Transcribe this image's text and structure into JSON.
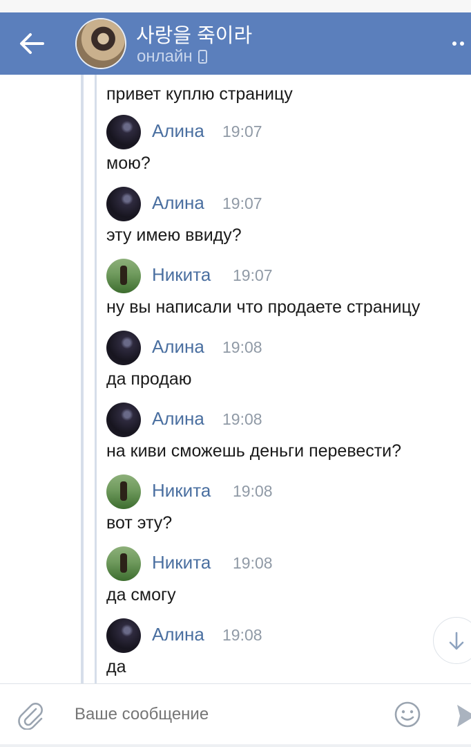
{
  "header": {
    "title": "사랑을 죽이라",
    "status": "онлайн",
    "colors": {
      "bar": "#5b7fbc",
      "status_text": "#c9d6ec"
    }
  },
  "messages": {
    "first_text": "привет куплю страницу",
    "items": [
      {
        "author": "Алина",
        "time": "19:07",
        "text": "мою?"
      },
      {
        "author": "Алина",
        "time": "19:07",
        "text": "эту имею ввиду?"
      },
      {
        "author": "Никита",
        "time": "19:07",
        "text": "ну вы написали что продаете страницу"
      },
      {
        "author": "Алина",
        "time": "19:08",
        "text": "да продаю"
      },
      {
        "author": "Алина",
        "time": "19:08",
        "text": "на киви сможешь деньги перевести?"
      },
      {
        "author": "Никита",
        "time": "19:08",
        "text": "вот эту?"
      },
      {
        "author": "Никита",
        "time": "19:08",
        "text": "да смогу"
      },
      {
        "author": "Алина",
        "time": "19:08",
        "text": "да"
      }
    ]
  },
  "composer": {
    "placeholder": "Ваше сообщение"
  },
  "icons": {
    "back": "arrow-left-icon",
    "menu": "more-dots-icon",
    "attach": "paperclip-icon",
    "emoji": "smiley-icon",
    "send": "send-icon",
    "scroll": "arrow-down-icon"
  },
  "colors": {
    "name": "#4a6fa0",
    "time": "#909aa6",
    "quote_line": "#d6deea"
  }
}
